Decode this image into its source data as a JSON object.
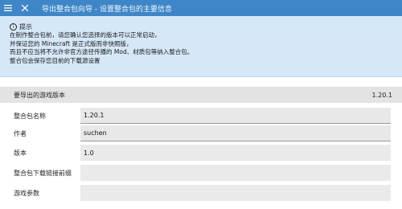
{
  "window": {
    "title": "导出整合包向导 - 设置整合包的主要信息",
    "menu_icon": "hamburger-menu-icon",
    "close_icon": "close-icon"
  },
  "notice": {
    "icon": "info-icon",
    "heading": "提示",
    "lines": [
      "在制作整合包前，请您确认您选择的版本可以正常启动，",
      "并保证您的 Minecraft 是正式版而非快照版，",
      "而且不应当将不允许非官方途径传播的 Mod、材质包等纳入整合包。",
      "整合包会保存您目前的下载源设置"
    ]
  },
  "export_version": {
    "label": "要导出的游戏版本",
    "value": "1.20.1"
  },
  "form": {
    "name": {
      "label": "整合包名称",
      "value": "1.20.1"
    },
    "author": {
      "label": "作者",
      "value": "suchen"
    },
    "version": {
      "label": "版本",
      "value": "1.0"
    },
    "download_link": {
      "label": "整合包下载链接前缀",
      "value": ""
    },
    "game_args": {
      "label": "游戏参数",
      "value": ""
    }
  },
  "colors": {
    "titlebar": "#3e86c7",
    "notice_bg": "#d6e8f8",
    "field_bg": "#e8e8e8"
  }
}
